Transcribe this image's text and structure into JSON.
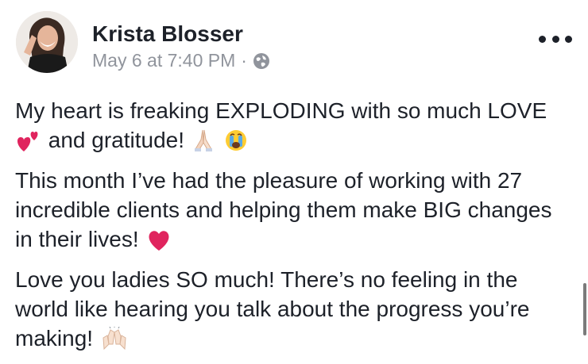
{
  "post": {
    "author": "Krista Blosser",
    "timestamp": "May 6 at 7:40 PM",
    "separator": "·",
    "privacy_icon": "globe-icon",
    "menu_icon": "more-options-icon",
    "paragraphs": {
      "p1_part1": "My heart is freaking EXPLODING with so much LOVE",
      "p1_part2": "and gratitude!",
      "p2_part1": "This month I’ve had the pleasure of working with 27 incredible clients and helping them make BIG changes in their lives!",
      "p3_part1": "Love you ladies SO much! There’s no feeling in the world like hearing you talk about the progress you’re making!"
    },
    "emojis": [
      "two-hearts-emoji",
      "praying-hands-emoji",
      "crying-face-emoji",
      "red-heart-emoji",
      "raising-hands-emoji"
    ]
  },
  "colors": {
    "text": "#1d2129",
    "meta": "#90949c",
    "heart": "#e0245e"
  }
}
